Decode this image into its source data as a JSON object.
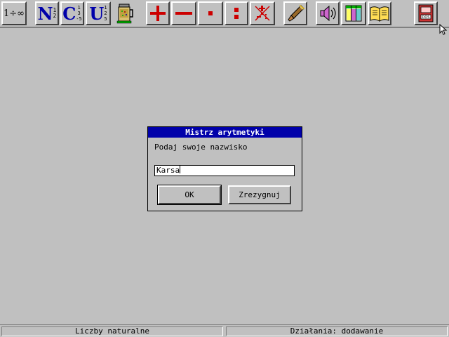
{
  "toolbar": {
    "infinity_label": "1÷∞",
    "natural_letter": "N",
    "natural_fraction": [
      "1",
      "2"
    ],
    "integer_letter": "C",
    "integer_numbers": [
      "1",
      "3",
      "-5"
    ],
    "fraction_letter": "U",
    "fraction_numbers": [
      "1",
      "2",
      "5"
    ]
  },
  "dialog": {
    "title": "Mistrz arytmetyki",
    "prompt": "Podaj swoje nazwisko",
    "input_value": "Karsa",
    "ok_label": "OK",
    "cancel_label": "Zrezygnuj"
  },
  "status": {
    "left": "Liczby naturalne",
    "right": "Działania: dodawanie"
  },
  "colors": {
    "background": "#c0c0c0",
    "title_bar": "#0000aa",
    "operator_red": "#cc0000",
    "toolbar_letter_blue": "#0000aa"
  },
  "icons": [
    "infinity-button",
    "natural-numbers-icon",
    "integers-icon",
    "fractions-icon",
    "calculator-beer-icon",
    "plus-icon",
    "minus-icon",
    "multiply-icon",
    "divide-icon",
    "mixed-operations-icon",
    "pencil-icon",
    "speaker-icon",
    "table-icon",
    "book-icon",
    "dos-exit-icon"
  ]
}
